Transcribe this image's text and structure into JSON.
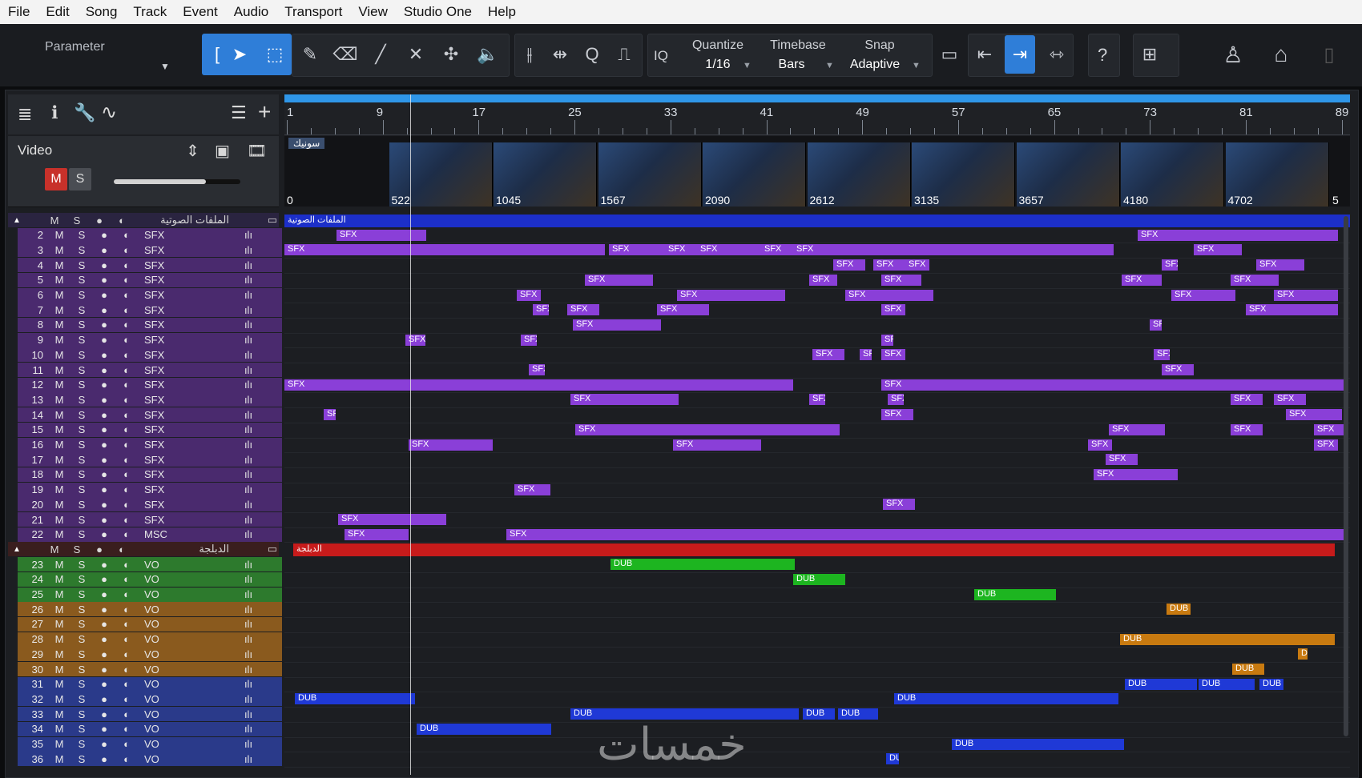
{
  "menu": [
    "File",
    "Edit",
    "Song",
    "Track",
    "Event",
    "Audio",
    "Transport",
    "View",
    "Studio One",
    "Help"
  ],
  "toolbar": {
    "parameter_label": "Parameter",
    "quantize_label": "Quantize",
    "quantize_value": "1/16",
    "timebase_label": "Timebase",
    "timebase_value": "Bars",
    "snap_label": "Snap",
    "snap_value": "Adaptive",
    "iq_label": "IQ",
    "help_label": "?",
    "active_color": "#2f7ed8"
  },
  "ruler": {
    "bars": [
      "1",
      "9",
      "17",
      "25",
      "33",
      "41",
      "49",
      "57",
      "65",
      "73",
      "81",
      "89"
    ]
  },
  "video_track": {
    "name": "Video",
    "mute_label": "M",
    "solo_label": "S",
    "clip_label": "سونيك",
    "frames": [
      "0",
      "522",
      "1045",
      "1567",
      "2090",
      "2612",
      "3135",
      "3657",
      "4180",
      "4702",
      "5"
    ]
  },
  "folders": {
    "sfx_folder": {
      "name": "الملفات الصوتية",
      "m": "M",
      "s": "S"
    },
    "dub_folder": {
      "name": "الدبلجة",
      "m": "M",
      "s": "S"
    }
  },
  "sfx_tracks": [
    {
      "num": "2",
      "name": "SFX"
    },
    {
      "num": "3",
      "name": "SFX"
    },
    {
      "num": "4",
      "name": "SFX"
    },
    {
      "num": "5",
      "name": "SFX"
    },
    {
      "num": "6",
      "name": "SFX"
    },
    {
      "num": "7",
      "name": "SFX"
    },
    {
      "num": "8",
      "name": "SFX"
    },
    {
      "num": "9",
      "name": "SFX"
    },
    {
      "num": "10",
      "name": "SFX"
    },
    {
      "num": "11",
      "name": "SFX"
    },
    {
      "num": "12",
      "name": "SFX"
    },
    {
      "num": "13",
      "name": "SFX"
    },
    {
      "num": "14",
      "name": "SFX"
    },
    {
      "num": "15",
      "name": "SFX"
    },
    {
      "num": "16",
      "name": "SFX"
    },
    {
      "num": "17",
      "name": "SFX"
    },
    {
      "num": "18",
      "name": "SFX"
    },
    {
      "num": "19",
      "name": "SFX"
    },
    {
      "num": "20",
      "name": "SFX"
    },
    {
      "num": "21",
      "name": "SFX"
    },
    {
      "num": "22",
      "name": "MSC"
    }
  ],
  "vo_tracks": [
    {
      "num": "23",
      "name": "VO",
      "color": "#2d7a2d"
    },
    {
      "num": "24",
      "name": "VO",
      "color": "#2d7a2d"
    },
    {
      "num": "25",
      "name": "VO",
      "color": "#2d7a2d"
    },
    {
      "num": "26",
      "name": "VO",
      "color": "#8a5a1e"
    },
    {
      "num": "27",
      "name": "VO",
      "color": "#8a5a1e"
    },
    {
      "num": "28",
      "name": "VO",
      "color": "#8a5a1e"
    },
    {
      "num": "29",
      "name": "VO",
      "color": "#8a5a1e"
    },
    {
      "num": "30",
      "name": "VO",
      "color": "#8a5a1e"
    },
    {
      "num": "31",
      "name": "VO",
      "color": "#2a3a8a"
    },
    {
      "num": "32",
      "name": "VO",
      "color": "#2a3a8a"
    },
    {
      "num": "33",
      "name": "VO",
      "color": "#2a3a8a"
    },
    {
      "num": "34",
      "name": "VO",
      "color": "#2a3a8a"
    },
    {
      "num": "35",
      "name": "VO",
      "color": "#2a3a8a"
    },
    {
      "num": "36",
      "name": "VO",
      "color": "#2a3a8a"
    }
  ],
  "track_buttons": {
    "m": "M",
    "s": "S",
    "rec": "●",
    "mon": "◐",
    "wave": "ılı"
  },
  "clip_labels": {
    "sfx": "SFX",
    "dub": "DUB",
    "sfx_folder": "الملفات الصوتية",
    "dub_folder": "الدبلجة"
  },
  "watermark": "خمسات",
  "colors": {
    "sfx_track": "#4a2a6e",
    "sfx_clip": "#8a3fd8",
    "dub_folder": "#c71b1b",
    "sfx_folder": "#1c2fc9",
    "ruler_bar": "#2f96e8"
  }
}
